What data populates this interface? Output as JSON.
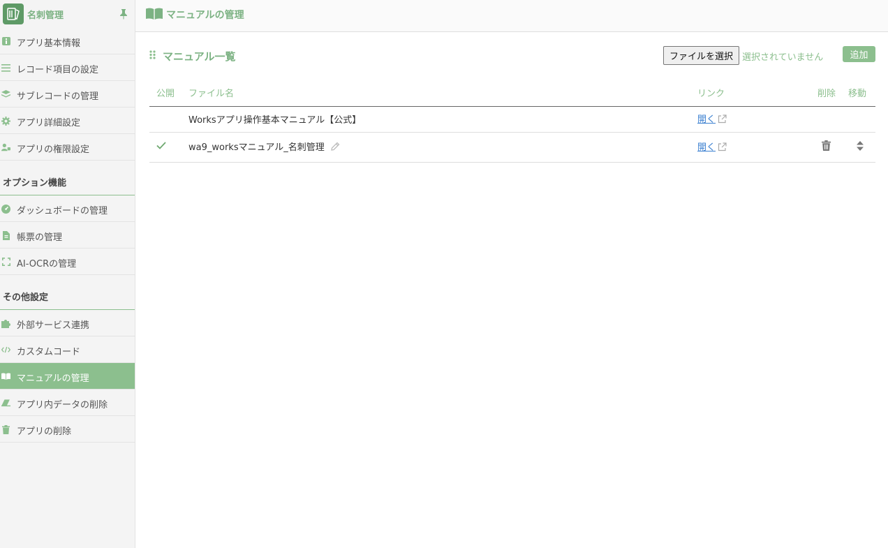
{
  "app": {
    "name": "名刺管理"
  },
  "sidebar": {
    "items": [
      {
        "label": "アプリ基本情報",
        "icon": "info-icon"
      },
      {
        "label": "レコード項目の設定",
        "icon": "list-icon"
      },
      {
        "label": "サブレコードの管理",
        "icon": "layers-icon"
      },
      {
        "label": "アプリ詳細設定",
        "icon": "gear-icon"
      },
      {
        "label": "アプリの権限設定",
        "icon": "users-icon"
      }
    ],
    "option_title": "オプション機能",
    "option_items": [
      {
        "label": "ダッシュボードの管理",
        "icon": "dashboard-icon"
      },
      {
        "label": "帳票の管理",
        "icon": "document-icon"
      },
      {
        "label": "AI-OCRの管理",
        "icon": "scan-icon"
      }
    ],
    "other_title": "その他設定",
    "other_items": [
      {
        "label": "外部サービス連携",
        "icon": "puzzle-icon"
      },
      {
        "label": "カスタムコード",
        "icon": "code-icon"
      },
      {
        "label": "マニュアルの管理",
        "icon": "book-icon",
        "active": true
      },
      {
        "label": "アプリ内データの削除",
        "icon": "eraser-icon"
      },
      {
        "label": "アプリの削除",
        "icon": "trash-icon"
      }
    ]
  },
  "header": {
    "title": "マニュアルの管理"
  },
  "manual": {
    "title": "マニュアル一覧",
    "file_button": "ファイルを選択",
    "file_status": "選択されていません",
    "add_button": "追加",
    "columns": {
      "public": "公開",
      "filename": "ファイル名",
      "link": "リンク",
      "delete": "削除",
      "move": "移動"
    },
    "rows": [
      {
        "public": false,
        "filename": "Worksアプリ操作基本マニュアル【公式】",
        "link": "開く"
      },
      {
        "public": true,
        "filename": "wa9_worksマニュアル_名刺管理",
        "link": "開く"
      }
    ]
  },
  "colors": {
    "accent": "#8cbf8e",
    "accent_text": "#7cb283",
    "link": "#3a7fd0"
  }
}
